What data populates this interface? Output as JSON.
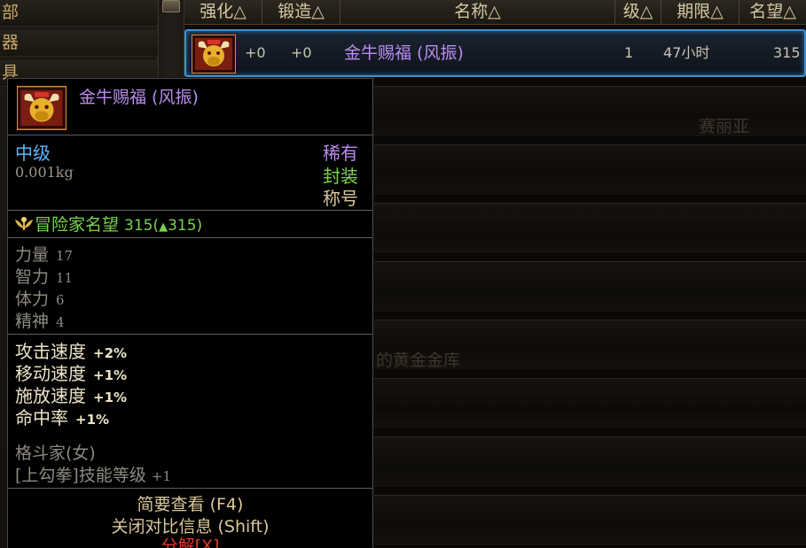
{
  "categories": [
    {
      "label": "部",
      "ghost": "  ∎∎∎ ∎∎∎∎∎∎∎"
    },
    {
      "label": "器",
      "ghost": ""
    },
    {
      "label": "具",
      "ghost": ""
    }
  ],
  "header": {
    "col_enhance": "强化△",
    "col_forge": "锻造△",
    "col_name": "名称△",
    "col_level": "级△",
    "col_expire": "期限△",
    "col_fame": "名望△"
  },
  "selected_row": {
    "enhance": "+0",
    "forge": "+0",
    "name": "金牛赐福 (风振)",
    "level": "1",
    "expire": "47小时",
    "fame": "315"
  },
  "background_text": {
    "row2": "赛丽亚",
    "row6": "的黄金金库"
  },
  "tooltip": {
    "title": "金牛赐福 (风振)",
    "grade": "中级",
    "weight": "0.001kg",
    "rarity": "稀有",
    "sealed": "封装",
    "kind": "称号",
    "fame_label": "冒险家名望",
    "fame_value": "315(",
    "fame_delta": "315)",
    "stats": [
      {
        "name": "力量",
        "value": "17"
      },
      {
        "name": "智力",
        "value": "11"
      },
      {
        "name": "体力",
        "value": "6"
      },
      {
        "name": "精神",
        "value": "4"
      }
    ],
    "bonuses": [
      {
        "name": "攻击速度",
        "value": "+2%"
      },
      {
        "name": "移动速度",
        "value": "+1%"
      },
      {
        "name": "施放速度",
        "value": "+1%"
      },
      {
        "name": "命中率",
        "value": "+1%"
      }
    ],
    "job": "格斗家(女)",
    "skill": "[上勾拳]技能等级",
    "skill_value": "+1",
    "btn_brief": "简要查看 (F4)",
    "btn_compare": "关闭对比信息 (Shift)",
    "btn_disassemble": "分解[X]"
  },
  "colors": {
    "rare": "#b98cf0",
    "grade": "#58b8ff",
    "sealed": "#7ad24e",
    "selection": "#3f8fd0",
    "danger": "#e33a2b"
  },
  "icons": {
    "item": "golden-bull-icon",
    "fame": "laurel-icon",
    "search": "magnifier-icon"
  }
}
